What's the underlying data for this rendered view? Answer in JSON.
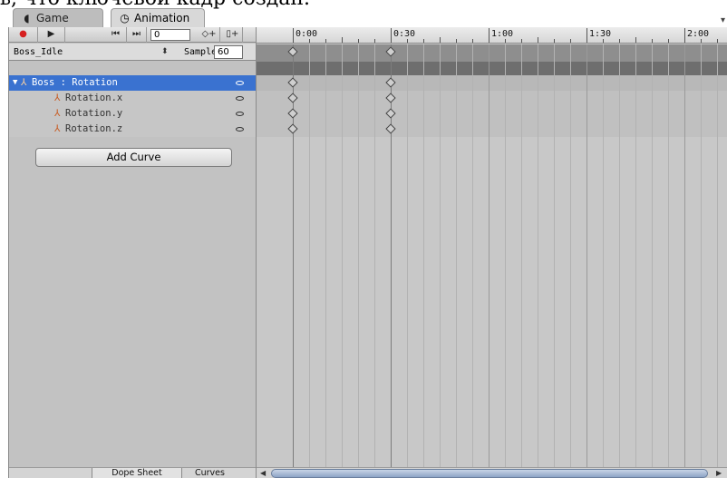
{
  "caption_fragment": "ь, что ключевой кадр создан.",
  "tabs": [
    {
      "label": "Game",
      "icon": "game-icon",
      "active": false
    },
    {
      "label": "Animation",
      "icon": "clock-icon",
      "active": true
    }
  ],
  "toolbar": {
    "frame_value": "0",
    "record_icon": "●",
    "play_icon": "▶",
    "prev_key_icon": "⏮",
    "next_key_icon": "⏭",
    "add_keyframe_icon": "◇+",
    "add_event_icon": "▯+"
  },
  "clip": {
    "name": "Boss_Idle",
    "sample_label": "Sample",
    "sample_value": "60"
  },
  "hierarchy": {
    "rows": [
      {
        "label": "Boss : Rotation",
        "selected": true
      },
      {
        "label": "Rotation.x",
        "selected": false
      },
      {
        "label": "Rotation.y",
        "selected": false
      },
      {
        "label": "Rotation.z",
        "selected": false
      }
    ],
    "add_curve_label": "Add Curve"
  },
  "view_modes": {
    "dope_sheet": "Dope Sheet",
    "curves": "Curves",
    "active": "Dope Sheet"
  },
  "timeline": {
    "ruler_labels": [
      "0:00",
      "0:30",
      "1:00",
      "1:30",
      "2:00"
    ],
    "keyframe_frames": [
      0,
      30
    ],
    "colors": {
      "selection": "#3a72d0",
      "record": "#d62020",
      "summary_band": "#6e6e6e"
    }
  }
}
